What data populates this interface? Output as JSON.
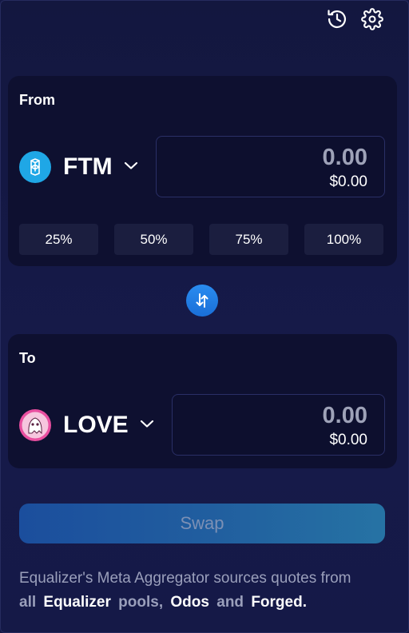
{
  "icons": {
    "history": "history-icon",
    "settings": "gear-icon",
    "chevron": "chevron-down-icon",
    "switch": "swap-arrows-icon"
  },
  "from": {
    "label": "From",
    "token": {
      "symbol": "FTM",
      "logo_color": "#1fa7e6"
    },
    "amount": {
      "value": "0.00",
      "usd": "$0.00"
    },
    "percents": [
      "25%",
      "50%",
      "75%",
      "100%"
    ]
  },
  "to": {
    "label": "To",
    "token": {
      "symbol": "LOVE",
      "logo_color": "#e94fa0"
    },
    "amount": {
      "value": "0.00",
      "usd": "$0.00"
    }
  },
  "swap_button": {
    "label": "Swap"
  },
  "footer": {
    "line1": "Equalizer's Meta Aggregator sources quotes from",
    "all": "all",
    "equalizer": "Equalizer",
    "pools": "pools,",
    "odos": "Odos",
    "and": "and",
    "forged": "Forged."
  },
  "colors": {
    "background": "#141845",
    "panel": "#0e1030",
    "accent": "#2a8cf0"
  }
}
